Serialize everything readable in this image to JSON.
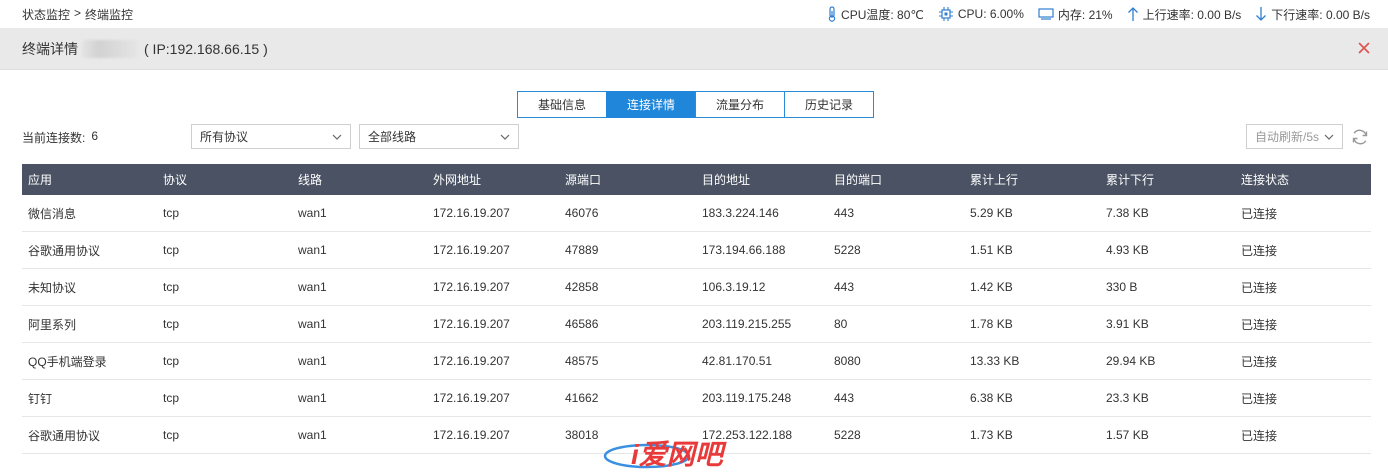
{
  "breadcrumb": {
    "parent": "状态监控",
    "separator": ">",
    "current": "终端监控"
  },
  "stats": {
    "cpu_temp": "CPU温度: 80℃",
    "cpu": "CPU: 6.00%",
    "memory": "内存: 21%",
    "upload": "上行速率: 0.00 B/s",
    "download": "下行速率: 0.00 B/s"
  },
  "header": {
    "title": "终端详情",
    "ip": "( IP:192.168.66.15 )"
  },
  "tabs": [
    {
      "label": "基础信息",
      "active": false
    },
    {
      "label": "连接详情",
      "active": true
    },
    {
      "label": "流量分布",
      "active": false
    },
    {
      "label": "历史记录",
      "active": false
    }
  ],
  "filters": {
    "count_label": "当前连接数:",
    "count_value": "6",
    "protocol_selected": "所有协议",
    "line_selected": "全部线路",
    "refresh_selected": "自动刷新/5s"
  },
  "table": {
    "columns": [
      "应用",
      "协议",
      "线路",
      "外网地址",
      "源端口",
      "目的地址",
      "目的端口",
      "累计上行",
      "累计下行",
      "连接状态"
    ],
    "rows": [
      [
        "微信消息",
        "tcp",
        "wan1",
        "172.16.19.207",
        "46076",
        "183.3.224.146",
        "443",
        "5.29 KB",
        "7.38 KB",
        "已连接"
      ],
      [
        "谷歌通用协议",
        "tcp",
        "wan1",
        "172.16.19.207",
        "47889",
        "173.194.66.188",
        "5228",
        "1.51 KB",
        "4.93 KB",
        "已连接"
      ],
      [
        "未知协议",
        "tcp",
        "wan1",
        "172.16.19.207",
        "42858",
        "106.3.19.12",
        "443",
        "1.42 KB",
        "330 B",
        "已连接"
      ],
      [
        "阿里系列",
        "tcp",
        "wan1",
        "172.16.19.207",
        "46586",
        "203.119.215.255",
        "80",
        "1.78 KB",
        "3.91 KB",
        "已连接"
      ],
      [
        "QQ手机端登录",
        "tcp",
        "wan1",
        "172.16.19.207",
        "48575",
        "42.81.170.51",
        "8080",
        "13.33 KB",
        "29.94 KB",
        "已连接"
      ],
      [
        "钉钉",
        "tcp",
        "wan1",
        "172.16.19.207",
        "41662",
        "203.119.175.248",
        "443",
        "6.38 KB",
        "23.3 KB",
        "已连接"
      ],
      [
        "谷歌通用协议",
        "tcp",
        "wan1",
        "172.16.19.207",
        "38018",
        "172.253.122.188",
        "5228",
        "1.73 KB",
        "1.57 KB",
        "已连接"
      ]
    ]
  },
  "watermark": {
    "text": "i爱网吧"
  },
  "colors": {
    "accent": "#1f86d9",
    "header_bg": "#4a5263",
    "close_red": "#e05050",
    "icon_blue": "#2f7fd0"
  },
  "icons": {
    "cpu_temp": "thermometer-icon",
    "cpu": "chip-icon",
    "memory": "monitor-icon",
    "upload": "arrow-up-icon",
    "download": "arrow-down-icon",
    "close": "close-icon",
    "refresh": "refresh-icon",
    "dropdown": "chevron-down-icon"
  }
}
